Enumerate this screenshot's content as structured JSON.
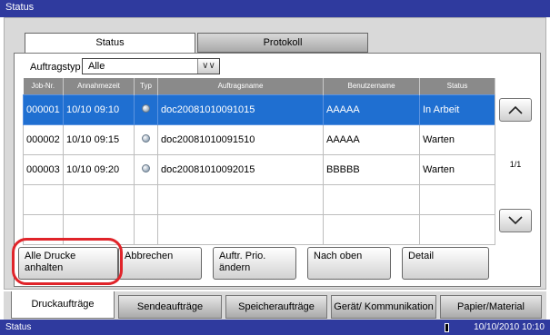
{
  "title": "Status",
  "tabs": [
    {
      "label": "Status",
      "active": true
    },
    {
      "label": "Protokoll",
      "active": false
    }
  ],
  "filter": {
    "label": "Auftragstyp",
    "selected": "Alle"
  },
  "table": {
    "columns": [
      "Job-Nr.",
      "Annahmezeit",
      "Typ",
      "Auftragsname",
      "Benutzername",
      "Status"
    ],
    "rows": [
      {
        "job": "000001",
        "time": "10/10 09:10",
        "icon": "document-icon",
        "name": "doc20081010091015",
        "user": "AAAAA",
        "status": "In Arbeit",
        "selected": true
      },
      {
        "job": "000002",
        "time": "10/10 09:15",
        "icon": "document-icon",
        "name": "doc20081010091510",
        "user": "AAAAA",
        "status": "Warten",
        "selected": false
      },
      {
        "job": "000003",
        "time": "10/10 09:20",
        "icon": "document-icon",
        "name": "doc20081010092015",
        "user": "BBBBB",
        "status": "Warten",
        "selected": false
      }
    ]
  },
  "pager": {
    "page": "1/1"
  },
  "actions": {
    "pause_all": "Alle Drucke anhalten",
    "cancel": "Abbrechen",
    "change_priority": "Auftr. Prio. ändern",
    "move_up": "Nach oben",
    "detail": "Detail"
  },
  "bottom_tabs": [
    {
      "label": "Druckaufträge",
      "active": true
    },
    {
      "label": "Sendeaufträge",
      "active": false
    },
    {
      "label": "Speicheraufträge",
      "active": false
    },
    {
      "label": "Gerät/ Kommunikation",
      "active": false
    },
    {
      "label": "Papier/Material",
      "active": false
    }
  ],
  "statusbar": {
    "left": "Status",
    "datetime": "10/10/2010 10:10"
  },
  "colors": {
    "titlebar": "#2f3a9e",
    "selected_row": "#1f6fd1",
    "highlight": "#e0242a"
  }
}
